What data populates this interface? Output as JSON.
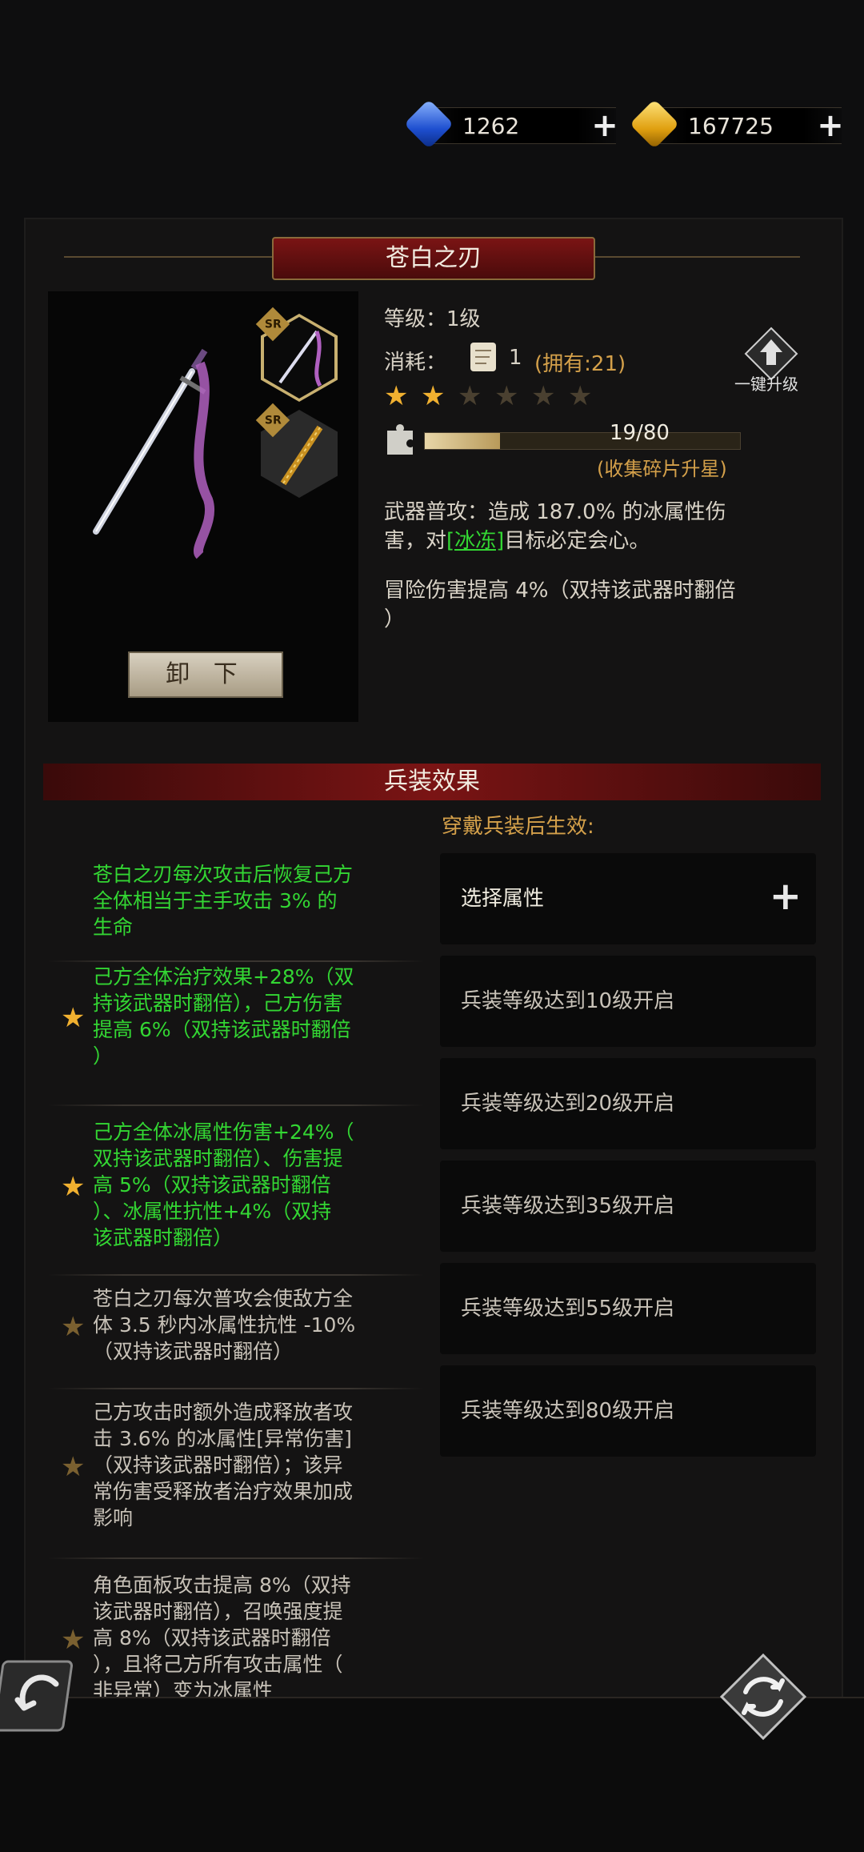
{
  "currency": {
    "gems": "1262",
    "gold": "167725"
  },
  "weapon": {
    "title": "苍白之刃",
    "rarity_1": "SR",
    "rarity_2": "SR",
    "unequip_label": "卸 下",
    "level_label": "等级：",
    "level_value": "1级",
    "cost_label": "消耗：",
    "cost_value": "1",
    "owned": "(拥有:21)",
    "stars_filled": 2,
    "stars_total": 6,
    "one_click_upgrade": "一键升级",
    "fragment_progress": "19/80",
    "fragment_progress_ratio": 0.2375,
    "collect_hint": "(收集碎片升星)",
    "desc_line1": "武器普攻：造成 187.0% 的冰属性伤",
    "desc_line2_pre": "害，对",
    "desc_line2_link": "[冰冻]",
    "desc_line2_post": "目标必定会心。",
    "bonus_line1": "冒险伤害提高 4%（双持该武器时翻倍",
    "bonus_line2": "）"
  },
  "effects": {
    "header": "兵装效果",
    "wear_hint": "穿戴兵装后生效:",
    "items": [
      {
        "lines": [
          "苍白之刃每次攻击后恢复己方",
          "全体相当于主手攻击 3% 的",
          "生命"
        ],
        "active": true,
        "star": false
      },
      {
        "lines": [
          "己方全体治疗效果+28%（双",
          "持该武器时翻倍），己方伤害",
          "提高 6%（双持该武器时翻倍",
          "）"
        ],
        "active": true,
        "star": true
      },
      {
        "lines": [
          "己方全体冰属性伤害+24%（",
          "双持该武器时翻倍）、伤害提",
          "高 5%（双持该武器时翻倍",
          "）、冰属性抗性+4%（双持",
          "该武器时翻倍）"
        ],
        "active": true,
        "star": true
      },
      {
        "lines": [
          "苍白之刃每次普攻会使敌方全",
          "体 3.5 秒内冰属性抗性 -10%",
          "（双持该武器时翻倍）"
        ],
        "active": false,
        "star": true
      },
      {
        "lines": [
          "己方攻击时额外造成释放者攻",
          "击 3.6% 的冰属性[异常伤害]",
          "（双持该武器时翻倍）；该异",
          "常伤害受释放者治疗效果加成",
          "影响"
        ],
        "active": false,
        "star": true
      },
      {
        "lines": [
          "角色面板攻击提高 8%（双持",
          "该武器时翻倍），召唤强度提",
          "高 8%（双持该武器时翻倍",
          "），且将己方所有攻击属性（",
          "非异常）变为冰属性"
        ],
        "active": false,
        "star": true
      }
    ],
    "slots": [
      "选择属性",
      "兵装等级达到10级开启",
      "兵装等级达到20级开启",
      "兵装等级达到35级开启",
      "兵装等级达到55级开启",
      "兵装等级达到80级开启"
    ]
  },
  "colors": {
    "active_effect": "#33d633",
    "banner_red": "#7a1414",
    "accent_gold": "#d4a04a"
  }
}
